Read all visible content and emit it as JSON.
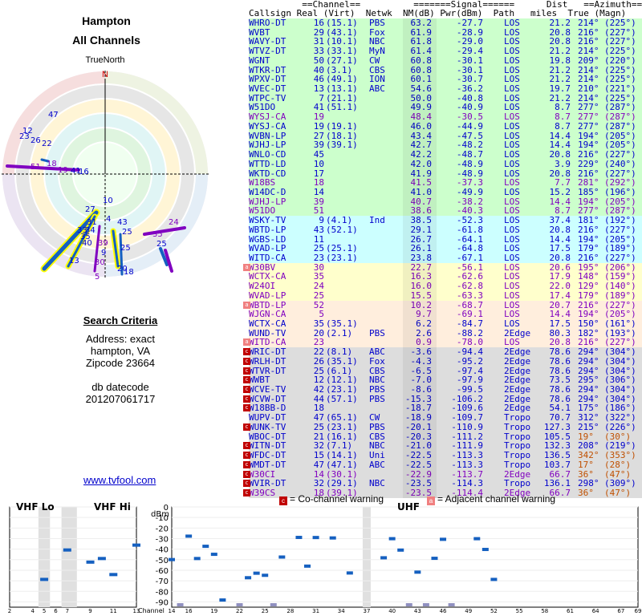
{
  "header": {
    "title": "Hampton",
    "subtitle": "All Channels"
  },
  "polar": {
    "north_label": "TrueNorth",
    "n_label": "N"
  },
  "polar_labels": [
    {
      "t": "47",
      "c": "#0000cc"
    },
    {
      "t": "12",
      "c": "#0000cc"
    },
    {
      "t": "23",
      "c": "#0000cc"
    },
    {
      "t": "26",
      "c": "#0000cc"
    },
    {
      "t": "22",
      "c": "#0000cc"
    },
    {
      "t": "51",
      "c": "#8000c0"
    },
    {
      "t": "18",
      "c": "#8000c0"
    },
    {
      "t": "19",
      "c": "#8000c0"
    },
    {
      "t": "41",
      "c": "#0000cc"
    },
    {
      "t": "16",
      "c": "#0000cc"
    },
    {
      "t": "10",
      "c": "#0000cc"
    },
    {
      "t": "27",
      "c": "#0000cc"
    },
    {
      "t": "4",
      "c": "#0000cc"
    },
    {
      "t": "31",
      "c": "#0000cc"
    },
    {
      "t": "34",
      "c": "#0000cc"
    },
    {
      "t": "35",
      "c": "#0000cc"
    },
    {
      "t": "33",
      "c": "#0000cc"
    },
    {
      "t": "40",
      "c": "#0000cc"
    },
    {
      "t": "39",
      "c": "#8000c0"
    },
    {
      "t": "9",
      "c": "#0000cc"
    },
    {
      "t": "43",
      "c": "#0000cc"
    },
    {
      "t": "25",
      "c": "#0000cc"
    },
    {
      "t": "13",
      "c": "#0000cc"
    },
    {
      "t": "30",
      "c": "#8000c0"
    },
    {
      "t": "5",
      "c": "#8000c0"
    },
    {
      "t": "20",
      "c": "#0000cc"
    },
    {
      "t": "18",
      "c": "#0000cc"
    },
    {
      "t": "25",
      "c": "#0000cc"
    },
    {
      "t": "24",
      "c": "#8000c0"
    },
    {
      "t": "35",
      "c": "#8000c0"
    },
    {
      "t": "25",
      "c": "#0000cc"
    }
  ],
  "criteria": {
    "heading": "Search Criteria",
    "address": "Address: exact",
    "city": "hampton, VA",
    "zip": "Zipcode 23664",
    "db1": "db datecode",
    "db2": "201207061717"
  },
  "link": "www.tvfool.com",
  "table": {
    "hdr1": "          ==Channel==          =======Signal======      Dist   ==Azimuth==",
    "hdr2": "Callsign Real (Virt)  Netwk  NM(dB) Pwr(dBm)  Path   miles  True (Magn)",
    "rows": [
      [
        "WHRO-DT",
        "16",
        "(15.1)",
        "PBS",
        "63.2",
        "-27.7",
        "LOS",
        "21.2",
        "214°",
        "(225°)",
        "b",
        "",
        "#ccffcc"
      ],
      [
        "WVBT",
        "29",
        "(43.1)",
        "Fox",
        "61.9",
        "-28.9",
        "LOS",
        "20.8",
        "216°",
        "(227°)",
        "b",
        "",
        "#ccffcc"
      ],
      [
        "WAVY-DT",
        "31",
        "(10.1)",
        "NBC",
        "61.8",
        "-29.0",
        "LOS",
        "20.8",
        "216°",
        "(227°)",
        "b",
        "",
        "#ccffcc"
      ],
      [
        "WTVZ-DT",
        "33",
        "(33.1)",
        "MyN",
        "61.4",
        "-29.4",
        "LOS",
        "21.2",
        "214°",
        "(225°)",
        "b",
        "",
        "#ccffcc"
      ],
      [
        "WGNT",
        "50",
        "(27.1)",
        "CW",
        "60.8",
        "-30.1",
        "LOS",
        "19.8",
        "209°",
        "(220°)",
        "b",
        "",
        "#ccffcc"
      ],
      [
        "WTKR-DT",
        "40",
        "(3.1)",
        "CBS",
        "60.8",
        "-30.1",
        "LOS",
        "21.2",
        "214°",
        "(225°)",
        "b",
        "",
        "#ccffcc"
      ],
      [
        "WPXV-DT",
        "46",
        "(49.1)",
        "ION",
        "60.1",
        "-30.7",
        "LOS",
        "21.2",
        "214°",
        "(225°)",
        "b",
        "",
        "#ccffcc"
      ],
      [
        "WVEC-DT",
        "13",
        "(13.1)",
        "ABC",
        "54.6",
        "-36.2",
        "LOS",
        "19.7",
        "210°",
        "(221°)",
        "b",
        "",
        "#ccffcc"
      ],
      [
        "WTPC-TV",
        "7",
        "(21.1)",
        "",
        "50.0",
        "-40.8",
        "LOS",
        "21.2",
        "214°",
        "(225°)",
        "b",
        "",
        "#ccffcc"
      ],
      [
        "W51DO",
        "41",
        "(51.1)",
        "",
        "49.9",
        "-40.9",
        "LOS",
        "8.7",
        "277°",
        "(287°)",
        "b",
        "",
        "#ccffcc"
      ],
      [
        "WYSJ-CA",
        "19",
        "",
        "",
        "48.4",
        "-30.5",
        "LOS",
        "8.7",
        "277°",
        "(287°)",
        "p",
        "",
        "#ccffcc"
      ],
      [
        "WYSJ-CA",
        "19",
        "(19.1)",
        "",
        "46.0",
        "-44.9",
        "LOS",
        "8.7",
        "277°",
        "(287°)",
        "b",
        "",
        "#ccffcc"
      ],
      [
        "WVBN-LP",
        "27",
        "(18.1)",
        "",
        "43.4",
        "-47.5",
        "LOS",
        "14.4",
        "194°",
        "(205°)",
        "b",
        "",
        "#ccffcc"
      ],
      [
        "WJHJ-LP",
        "39",
        "(39.1)",
        "",
        "42.7",
        "-48.2",
        "LOS",
        "14.4",
        "194°",
        "(205°)",
        "b",
        "",
        "#ccffcc"
      ],
      [
        "WNLO-CD",
        "45",
        "",
        "",
        "42.2",
        "-48.7",
        "LOS",
        "20.8",
        "216°",
        "(227°)",
        "b",
        "",
        "#ccffcc"
      ],
      [
        "WTTD-LD",
        "10",
        "",
        "",
        "42.0",
        "-48.9",
        "LOS",
        "3.9",
        "229°",
        "(240°)",
        "b",
        "",
        "#ccffcc"
      ],
      [
        "WKTD-CD",
        "17",
        "",
        "",
        "41.9",
        "-48.9",
        "LOS",
        "20.8",
        "216°",
        "(227°)",
        "b",
        "",
        "#ccffcc"
      ],
      [
        "W18BS",
        "18",
        "",
        "",
        "41.5",
        "-37.3",
        "LOS",
        "7.7",
        "281°",
        "(292°)",
        "p",
        "",
        "#ccffcc"
      ],
      [
        "W14DC-D",
        "14",
        "",
        "",
        "41.0",
        "-49.9",
        "LOS",
        "15.2",
        "185°",
        "(196°)",
        "b",
        "",
        "#ccffcc"
      ],
      [
        "WJHJ-LP",
        "39",
        "",
        "",
        "40.7",
        "-38.2",
        "LOS",
        "14.4",
        "194°",
        "(205°)",
        "p",
        "",
        "#ccffcc"
      ],
      [
        "W51DO",
        "51",
        "",
        "",
        "38.6",
        "-40.3",
        "LOS",
        "8.7",
        "277°",
        "(287°)",
        "p",
        "",
        "#ccffcc"
      ],
      [
        "WSKY-TV",
        "9",
        "(4.1)",
        "Ind",
        "38.5",
        "-52.3",
        "LOS",
        "37.4",
        "181°",
        "(192°)",
        "b",
        "",
        "#ccffff"
      ],
      [
        "WBTD-LP",
        "43",
        "(52.1)",
        "",
        "29.1",
        "-61.8",
        "LOS",
        "20.8",
        "216°",
        "(227°)",
        "b",
        "",
        "#ccffff"
      ],
      [
        "WGBS-LD",
        "11",
        "",
        "",
        "26.7",
        "-64.1",
        "LOS",
        "14.4",
        "194°",
        "(205°)",
        "b",
        "",
        "#ccffff"
      ],
      [
        "WVAD-LP",
        "25",
        "(25.1)",
        "",
        "26.1",
        "-64.8",
        "LOS",
        "17.5",
        "179°",
        "(189°)",
        "b",
        "",
        "#ccffff"
      ],
      [
        "WITD-CA",
        "23",
        "(23.1)",
        "",
        "23.8",
        "-67.1",
        "LOS",
        "20.8",
        "216°",
        "(227°)",
        "b",
        "",
        "#ccffff"
      ],
      [
        "W30BV",
        "30",
        "",
        "",
        "22.7",
        "-56.1",
        "LOS",
        "20.6",
        "195°",
        "(206°)",
        "p",
        "a",
        "#ffffcc"
      ],
      [
        "WCTX-CA",
        "35",
        "",
        "",
        "16.3",
        "-62.6",
        "LOS",
        "17.9",
        "148°",
        "(159°)",
        "p",
        "",
        "#ffffcc"
      ],
      [
        "W24OI",
        "24",
        "",
        "",
        "16.0",
        "-62.8",
        "LOS",
        "22.0",
        "129°",
        "(140°)",
        "p",
        "",
        "#ffffcc"
      ],
      [
        "WVAD-LP",
        "25",
        "",
        "",
        "15.5",
        "-63.3",
        "LOS",
        "17.4",
        "179°",
        "(189°)",
        "p",
        "",
        "#ffffcc"
      ],
      [
        "WBTD-LP",
        "52",
        "",
        "",
        "10.2",
        "-68.7",
        "LOS",
        "20.7",
        "216°",
        "(227°)",
        "p",
        "a",
        "#ffeedd"
      ],
      [
        "WJGN-CA",
        "5",
        "",
        "",
        "9.7",
        "-69.1",
        "LOS",
        "14.4",
        "194°",
        "(205°)",
        "p",
        "",
        "#ffeedd"
      ],
      [
        "WCTX-CA",
        "35",
        "(35.1)",
        "",
        "6.2",
        "-84.7",
        "LOS",
        "17.5",
        "150°",
        "(161°)",
        "b",
        "",
        "#ffeedd"
      ],
      [
        "WUND-TV",
        "20",
        "(2.1)",
        "PBS",
        "2.6",
        "-88.2",
        "2Edge",
        "80.3",
        "182°",
        "(193°)",
        "b",
        "",
        "#ffeedd"
      ],
      [
        "WITD-CA",
        "23",
        "",
        "",
        "0.9",
        "-78.0",
        "LOS",
        "20.8",
        "216°",
        "(227°)",
        "p",
        "a",
        "#ffeedd"
      ],
      [
        "WRIC-DT",
        "22",
        "(8.1)",
        "ABC",
        "-3.6",
        "-94.4",
        "2Edge",
        "78.6",
        "294°",
        "(304°)",
        "b",
        "c",
        "#dddddd"
      ],
      [
        "WRLH-DT",
        "26",
        "(35.1)",
        "Fox",
        "-4.3",
        "-95.2",
        "2Edge",
        "78.6",
        "294°",
        "(304°)",
        "b",
        "c",
        "#dddddd"
      ],
      [
        "WTVR-DT",
        "25",
        "(6.1)",
        "CBS",
        "-6.5",
        "-97.4",
        "2Edge",
        "78.6",
        "294°",
        "(304°)",
        "b",
        "c",
        "#dddddd"
      ],
      [
        "WWBT",
        "12",
        "(12.1)",
        "NBC",
        "-7.0",
        "-97.9",
        "2Edge",
        "73.5",
        "295°",
        "(306°)",
        "b",
        "c",
        "#dddddd"
      ],
      [
        "WCVE-TV",
        "42",
        "(23.1)",
        "PBS",
        "-8.6",
        "-99.5",
        "2Edge",
        "78.6",
        "294°",
        "(304°)",
        "b",
        "c",
        "#dddddd"
      ],
      [
        "WCVW-DT",
        "44",
        "(57.1)",
        "PBS",
        "-15.3",
        "-106.2",
        "2Edge",
        "78.6",
        "294°",
        "(304°)",
        "b",
        "c",
        "#dddddd"
      ],
      [
        "W18BB-D",
        "18",
        "",
        "",
        "-18.7",
        "-109.6",
        "2Edge",
        "54.1",
        "175°",
        "(186°)",
        "b",
        "c",
        "#dddddd"
      ],
      [
        "WUPV-DT",
        "47",
        "(65.1)",
        "CW",
        "-18.9",
        "-109.7",
        "Tropo",
        "70.7",
        "312°",
        "(322°)",
        "b",
        "",
        "#dddddd"
      ],
      [
        "WUNK-TV",
        "25",
        "(23.1)",
        "PBS",
        "-20.1",
        "-110.9",
        "Tropo",
        "127.3",
        "215°",
        "(226°)",
        "b",
        "c",
        "#dddddd"
      ],
      [
        "WBOC-DT",
        "21",
        "(16.1)",
        "CBS",
        "-20.3",
        "-111.2",
        "Tropo",
        "105.5",
        "19°",
        "(30°)",
        "b",
        "",
        "#dddddd"
      ],
      [
        "WITN-DT",
        "32",
        "(7.1)",
        "NBC",
        "-21.0",
        "-111.9",
        "Tropo",
        "132.3",
        "208°",
        "(219°)",
        "b",
        "c",
        "#dddddd"
      ],
      [
        "WFDC-DT",
        "15",
        "(14.1)",
        "Uni",
        "-22.5",
        "-113.3",
        "Tropo",
        "136.5",
        "342°",
        "(353°)",
        "b",
        "c",
        "#dddddd"
      ],
      [
        "WMDT-DT",
        "47",
        "(47.1)",
        "ABC",
        "-22.5",
        "-113.3",
        "Tropo",
        "103.7",
        "17°",
        "(28°)",
        "b",
        "c",
        "#dddddd"
      ],
      [
        "W30CI",
        "14",
        "(30.1)",
        "",
        "-22.9",
        "-113.7",
        "2Edge",
        "66.7",
        "36°",
        "(47°)",
        "p",
        "c",
        "#dddddd"
      ],
      [
        "WVIR-DT",
        "32",
        "(29.1)",
        "NBC",
        "-23.5",
        "-114.3",
        "Tropo",
        "136.1",
        "298°",
        "(309°)",
        "b",
        "c",
        "#dddddd"
      ],
      [
        "W39CS",
        "18",
        "(39.1)",
        "",
        "-23.5",
        "-114.4",
        "2Edge",
        "66.7",
        "36°",
        "(47°)",
        "p",
        "c",
        "#dddddd"
      ]
    ]
  },
  "legend": {
    "co": "= Co-channel warning",
    "adj": "= Adjacent channel warning",
    "co_glyph": "c",
    "adj_glyph": "a"
  },
  "chart": {
    "vhf_lo": "VHF Lo",
    "vhf_hi": "VHF Hi",
    "uhf": "UHF",
    "dbm": "dBm",
    "channel_label": "Channel",
    "yticks": [
      "0",
      "-10",
      "-20",
      "-30",
      "-40",
      "-50",
      "-60",
      "-70",
      "-80",
      "-90"
    ],
    "xticks_vhf": [
      "2",
      "4",
      "5",
      "6",
      "7",
      "9",
      "11",
      "13"
    ],
    "xticks_uhf": [
      "14",
      "16",
      "19",
      "22",
      "25",
      "28",
      "31",
      "34",
      "37",
      "40",
      "43",
      "46",
      "49",
      "52",
      "55",
      "58",
      "61",
      "64",
      "67",
      "69"
    ]
  },
  "chart_data": {
    "type": "scatter",
    "xlabel": "Channel",
    "ylabel": "dBm",
    "ylim": [
      -95,
      0
    ],
    "series": [
      {
        "name": "VHF",
        "x": [
          5,
          7,
          9,
          10,
          11,
          13
        ],
        "y": [
          -68.7,
          -40.8,
          -52.3,
          -48.9,
          -64.1,
          -36.2
        ]
      },
      {
        "name": "UHF",
        "x": [
          14,
          15,
          16,
          17,
          18,
          19,
          20,
          22,
          23,
          24,
          25,
          26,
          27,
          29,
          30,
          31,
          33,
          35,
          39,
          40,
          41,
          42,
          43,
          44,
          45,
          46,
          47,
          50,
          51,
          52
        ],
        "y": [
          -49.9,
          -113.3,
          -27.7,
          -48.9,
          -37.3,
          -44.9,
          -88.2,
          -94.4,
          -67.1,
          -62.8,
          -64.8,
          -95.2,
          -47.5,
          -28.9,
          -56.1,
          -29.0,
          -29.4,
          -62.6,
          -48.2,
          -30.1,
          -40.9,
          -99.5,
          -61.8,
          -106.2,
          -48.7,
          -30.7,
          -109.7,
          -30.1,
          -40.3,
          -68.7
        ]
      }
    ]
  }
}
